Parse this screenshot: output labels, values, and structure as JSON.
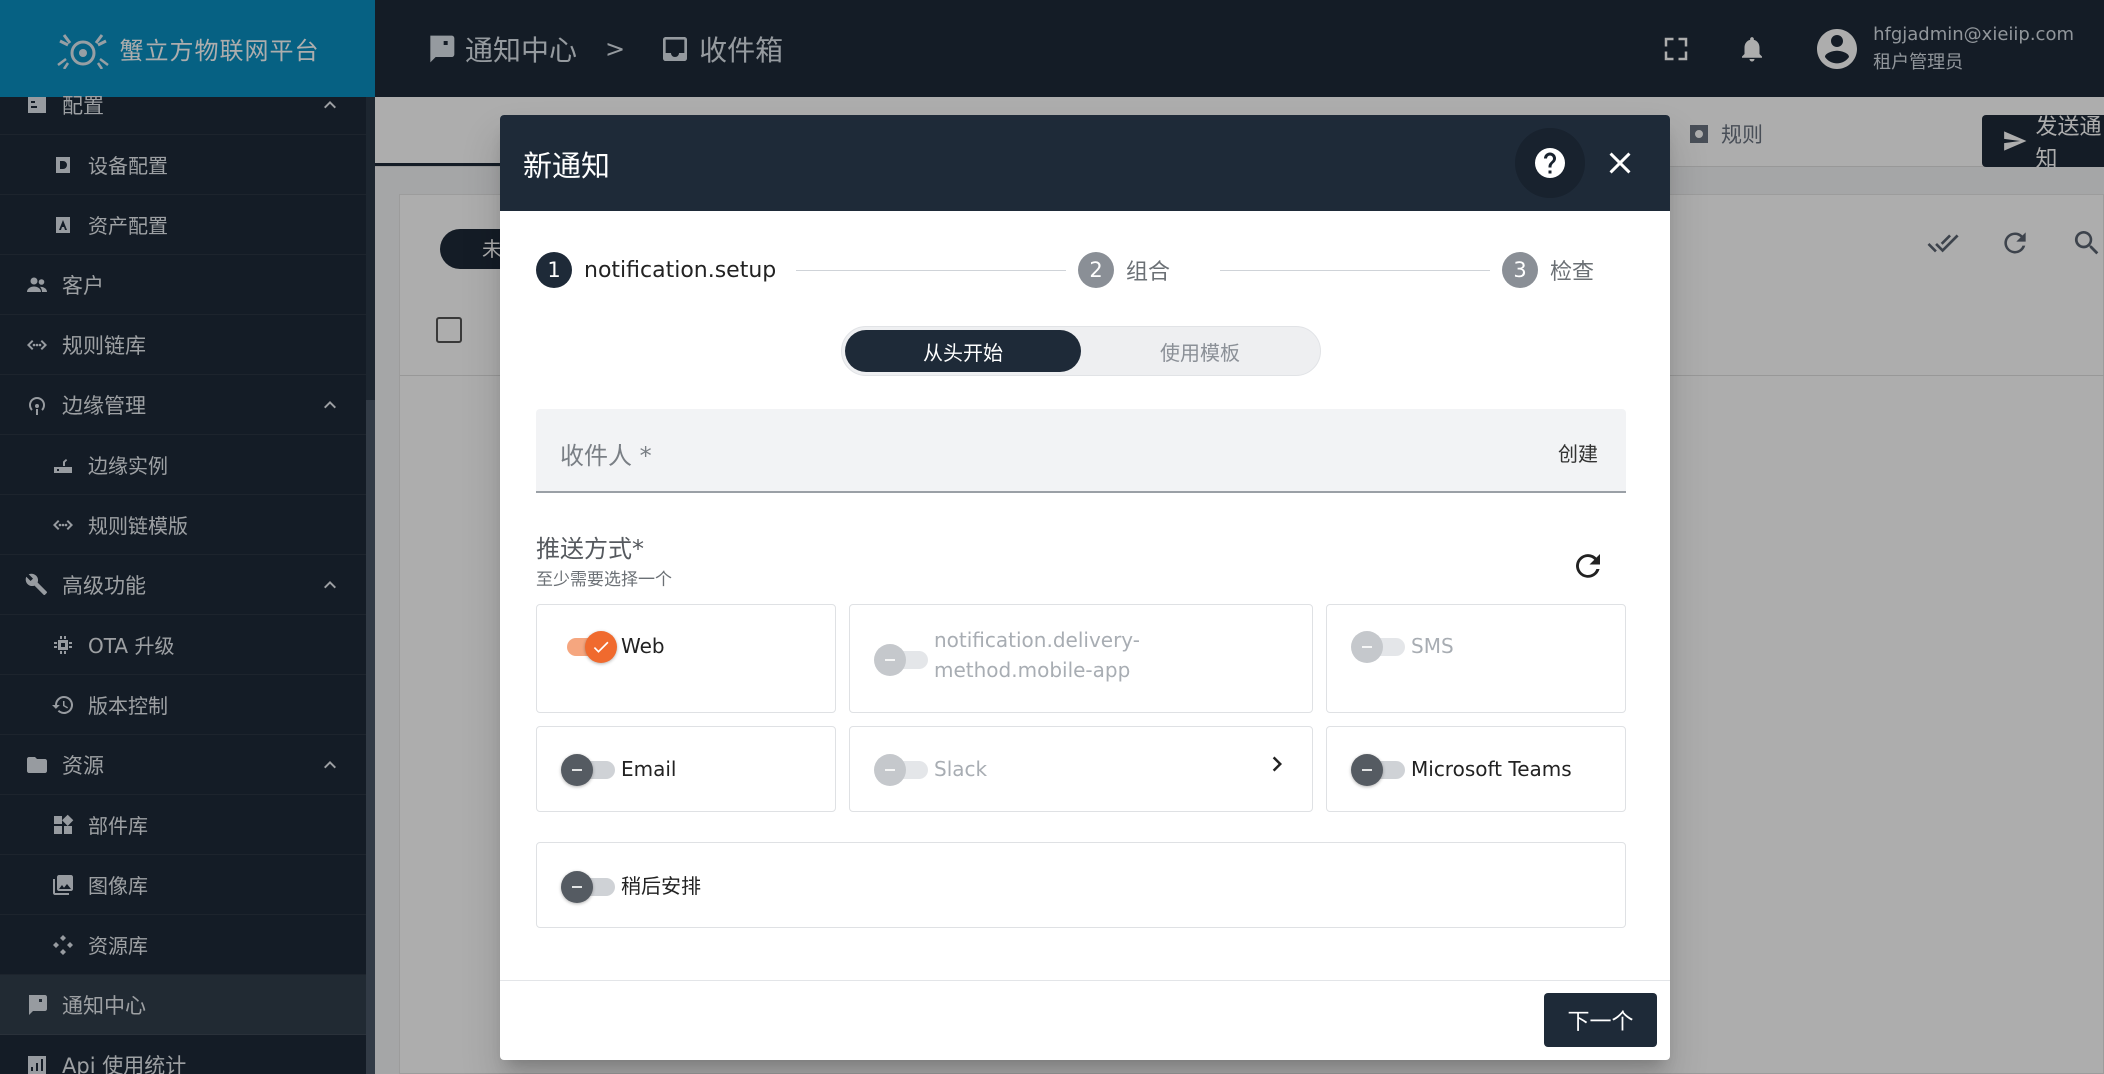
{
  "brand": {
    "name": "蟹立方物联网平台"
  },
  "sidebar": {
    "items": [
      {
        "label": "配置",
        "level": "top",
        "icon": "settings-icon",
        "expanded": true,
        "partial": true
      },
      {
        "label": "设备配置",
        "level": "sub",
        "icon": "device-profile-icon"
      },
      {
        "label": "资产配置",
        "level": "sub",
        "icon": "asset-profile-icon"
      },
      {
        "label": "客户",
        "level": "top",
        "icon": "customers-icon"
      },
      {
        "label": "规则链库",
        "level": "top",
        "icon": "rule-chain-icon"
      },
      {
        "label": "边缘管理",
        "level": "top",
        "icon": "edge-icon",
        "expanded": true
      },
      {
        "label": "边缘实例",
        "level": "sub",
        "icon": "router-icon"
      },
      {
        "label": "规则链模版",
        "level": "sub",
        "icon": "rule-chain-icon"
      },
      {
        "label": "高级功能",
        "level": "top",
        "icon": "tools-icon",
        "expanded": true
      },
      {
        "label": "OTA 升级",
        "level": "sub",
        "icon": "chip-icon"
      },
      {
        "label": "版本控制",
        "level": "sub",
        "icon": "history-icon"
      },
      {
        "label": "资源",
        "level": "top",
        "icon": "folder-icon",
        "expanded": true
      },
      {
        "label": "部件库",
        "level": "sub",
        "icon": "widgets-icon"
      },
      {
        "label": "图像库",
        "level": "sub",
        "icon": "image-icon"
      },
      {
        "label": "资源库",
        "level": "sub",
        "icon": "resources-icon"
      },
      {
        "label": "通知中心",
        "level": "top",
        "icon": "notification-center-icon",
        "active": true
      },
      {
        "label": "Api 使用统计",
        "level": "top",
        "icon": "chart-icon"
      }
    ]
  },
  "topbar": {
    "breadcrumb": [
      "通知中心",
      "收件箱"
    ],
    "separator": ">",
    "user_email": "hfgjadmin@xieiip.com",
    "user_role": "租户管理员"
  },
  "background": {
    "rules_tab": "规则",
    "send_button": "发送通知",
    "filter_pill": "未读"
  },
  "dialog": {
    "title": "新通知",
    "steps": [
      {
        "num": "1",
        "label": "notification.setup",
        "active": true
      },
      {
        "num": "2",
        "label": "组合",
        "active": false
      },
      {
        "num": "3",
        "label": "检查",
        "active": false
      }
    ],
    "segmented": {
      "option_1": "从头开始",
      "option_2": "使用模板",
      "selected": "从头开始"
    },
    "recipients": {
      "label": "收件人 *",
      "create": "创建"
    },
    "delivery": {
      "title": "推送方式*",
      "hint": "至少需要选择一个",
      "methods": [
        {
          "label": "Web",
          "state": "on"
        },
        {
          "label": "notification.delivery-method.mobile-app",
          "state": "disabled"
        },
        {
          "label": "SMS",
          "state": "disabled"
        },
        {
          "label": "Email",
          "state": "off"
        },
        {
          "label": "Slack",
          "state": "disabled"
        },
        {
          "label": "Microsoft Teams",
          "state": "off"
        }
      ]
    },
    "schedule": {
      "label": "稍后安排",
      "state": "off"
    },
    "next_button": "下一个"
  },
  "colors": {
    "sidebar_bg": "#1e2a38",
    "brand_bg": "#0a8fc1",
    "toggle_on": "#f06a2e",
    "toggle_off": "#555b62"
  }
}
